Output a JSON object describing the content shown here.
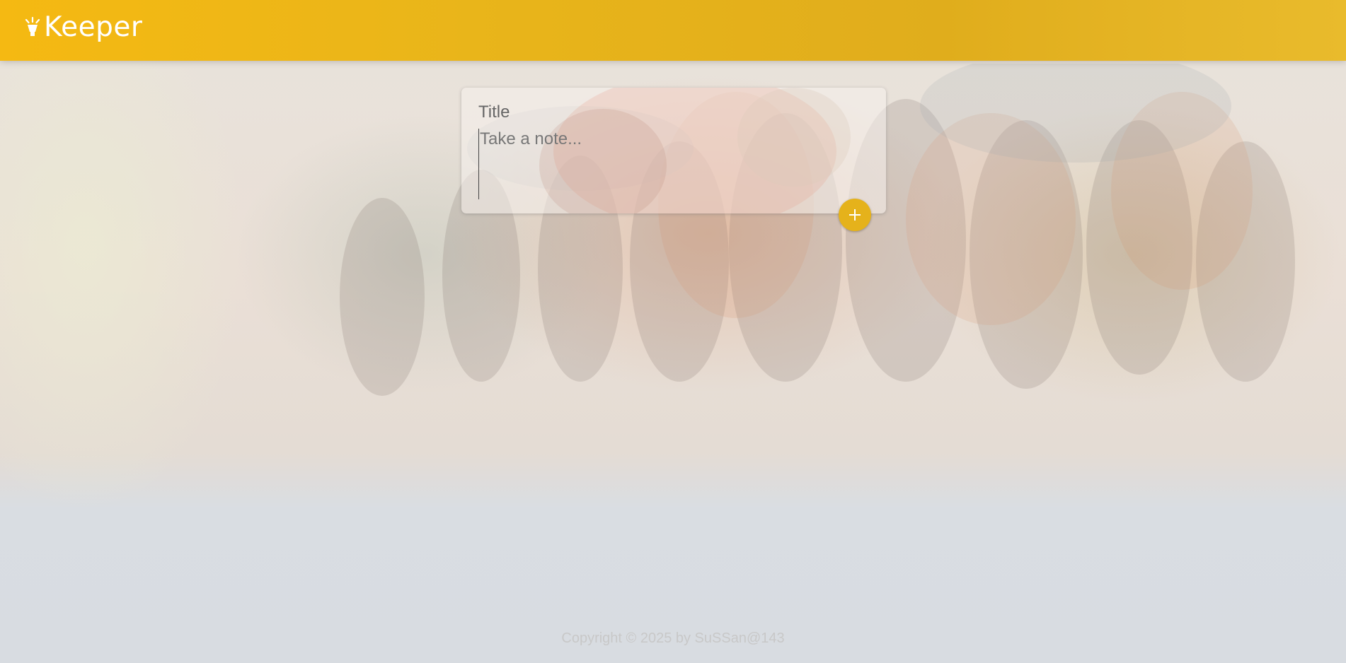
{
  "header": {
    "app_name": "Keeper",
    "logo_icon": "highlight-lightbulb-icon",
    "color": "#f5b912"
  },
  "note_form": {
    "title_placeholder": "Title",
    "content_placeholder": "Take a note...",
    "add_button_icon": "plus-icon",
    "add_button_color": "#e5b21b"
  },
  "footer": {
    "text": "Copyright © 2025 by SuSSan@143"
  }
}
